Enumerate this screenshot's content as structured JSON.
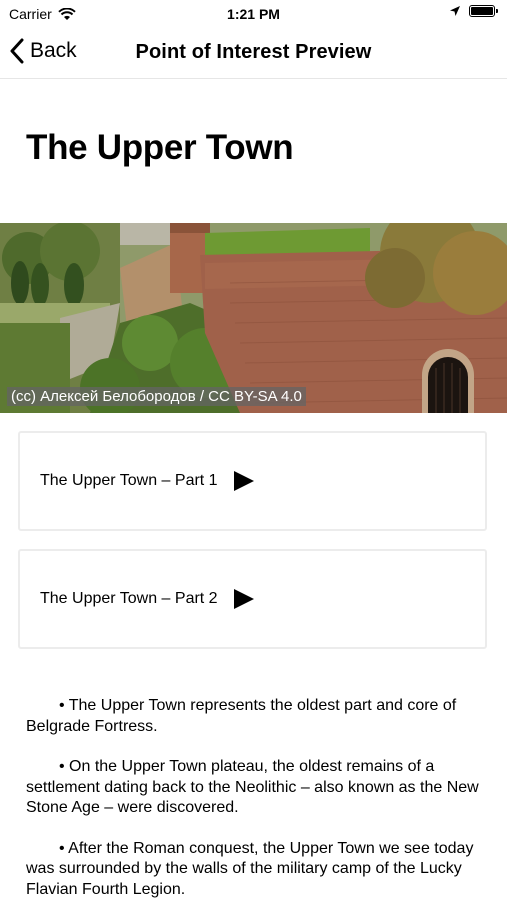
{
  "status": {
    "carrier": "Carrier",
    "time": "1:21 PM"
  },
  "nav": {
    "back_label": "Back",
    "title": "Point of Interest Preview"
  },
  "page": {
    "title": "The Upper Town"
  },
  "image": {
    "credit": "(cc) Алексей Белобородов / CC BY-SA 4.0"
  },
  "audio": [
    {
      "label": "The Upper Town – Part 1",
      "icon": "play-icon"
    },
    {
      "label": "The Upper Town – Part 2",
      "icon": "play-icon"
    }
  ],
  "content": {
    "paragraphs": [
      "• The Upper Town represents the oldest part and core of Belgrade Fortress.",
      "• On the Upper Town plateau, the oldest remains of a settlement dating back to the Neolithic – also known as the New Stone Age – were discovered.",
      "• After the Roman conquest, the Upper Town we see today was surrounded by the walls of the military camp of the Lucky Flavian Fourth Legion."
    ]
  }
}
